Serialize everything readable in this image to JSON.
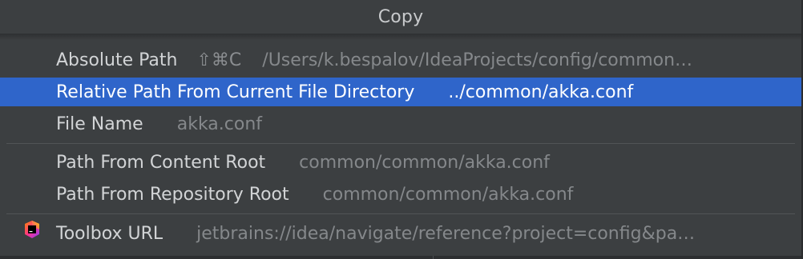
{
  "popup": {
    "title": "Copy"
  },
  "items": [
    {
      "label": "Absolute Path",
      "shortcut": "⇧⌘C",
      "value": "/Users/k.bespalov/IdeaProjects/config/common…"
    },
    {
      "label": "Relative Path From Current File Directory",
      "value": "../common/akka.conf",
      "selected": true
    },
    {
      "label": "File Name",
      "value": "akka.conf"
    },
    {
      "label": "Path From Content Root",
      "value": "common/common/akka.conf"
    },
    {
      "label": "Path From Repository Root",
      "value": "common/common/akka.conf"
    },
    {
      "label": "Toolbox URL",
      "value": "jetbrains://idea/navigate/reference?project=config&pa…",
      "icon": "toolbox-app-icon"
    }
  ],
  "colors": {
    "selection": "#2f65ca",
    "background": "#3c3f41",
    "label": "#d2d4d6",
    "muted": "#85888b"
  }
}
